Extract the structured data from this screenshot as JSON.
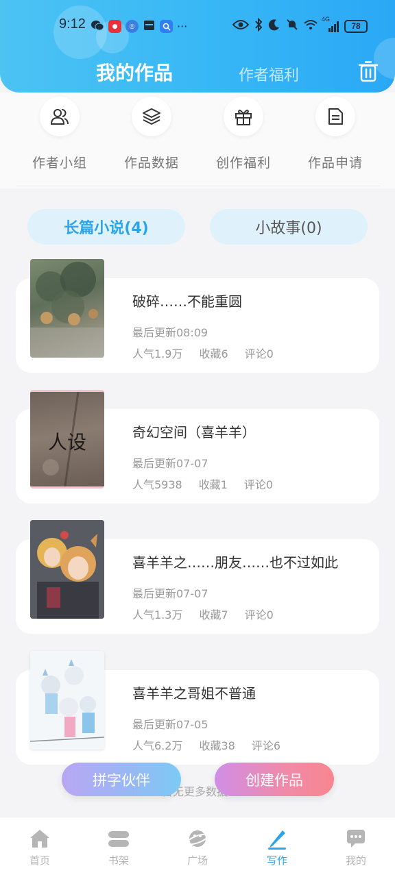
{
  "status_bar": {
    "time": "9:12",
    "network": "4G",
    "battery": "78"
  },
  "header": {
    "tab_active": "我的作品",
    "tab_inactive": "作者福利",
    "trash_icon": "trash-icon",
    "background_color": "#39b8f6"
  },
  "quick_actions": [
    {
      "label": "作者小组",
      "icon": "users-icon"
    },
    {
      "label": "作品数据",
      "icon": "layers-icon"
    },
    {
      "label": "创作福利",
      "icon": "gift-icon"
    },
    {
      "label": "作品申请",
      "icon": "document-icon"
    }
  ],
  "segments": {
    "novels": "长篇小说(4)",
    "stories": "小故事(0)"
  },
  "works": [
    {
      "title": "破碎……不能重圆",
      "updated": "最后更新08:09",
      "popularity": "人气1.9万",
      "favorites": "收藏6",
      "comments": "评论0"
    },
    {
      "title": "奇幻空间（喜羊羊）",
      "updated": "最后更新07-07",
      "popularity": "人气5938",
      "favorites": "收藏1",
      "comments": "评论0",
      "cover_text": "人设"
    },
    {
      "title": "喜羊羊之……朋友……也不过如此",
      "updated": "最后更新07-07",
      "popularity": "人气1.3万",
      "favorites": "收藏7",
      "comments": "评论0"
    },
    {
      "title": "喜羊羊之哥姐不普通",
      "updated": "最后更新07-05",
      "popularity": "人气6.2万",
      "favorites": "收藏38",
      "comments": "评论6"
    }
  ],
  "footer_hint": "暂无更多数据",
  "floating_buttons": {
    "partner": "拼字伙伴",
    "create": "创建作品"
  },
  "bottom_nav": [
    {
      "label": "首页",
      "icon": "home-icon"
    },
    {
      "label": "书架",
      "icon": "bookshelf-icon"
    },
    {
      "label": "广场",
      "icon": "planet-icon"
    },
    {
      "label": "写作",
      "icon": "pen-icon",
      "active": true
    },
    {
      "label": "我的",
      "icon": "chat-icon"
    }
  ],
  "colors": {
    "accent": "#2aa5ea",
    "nav_inactive": "#b5b5b5"
  }
}
